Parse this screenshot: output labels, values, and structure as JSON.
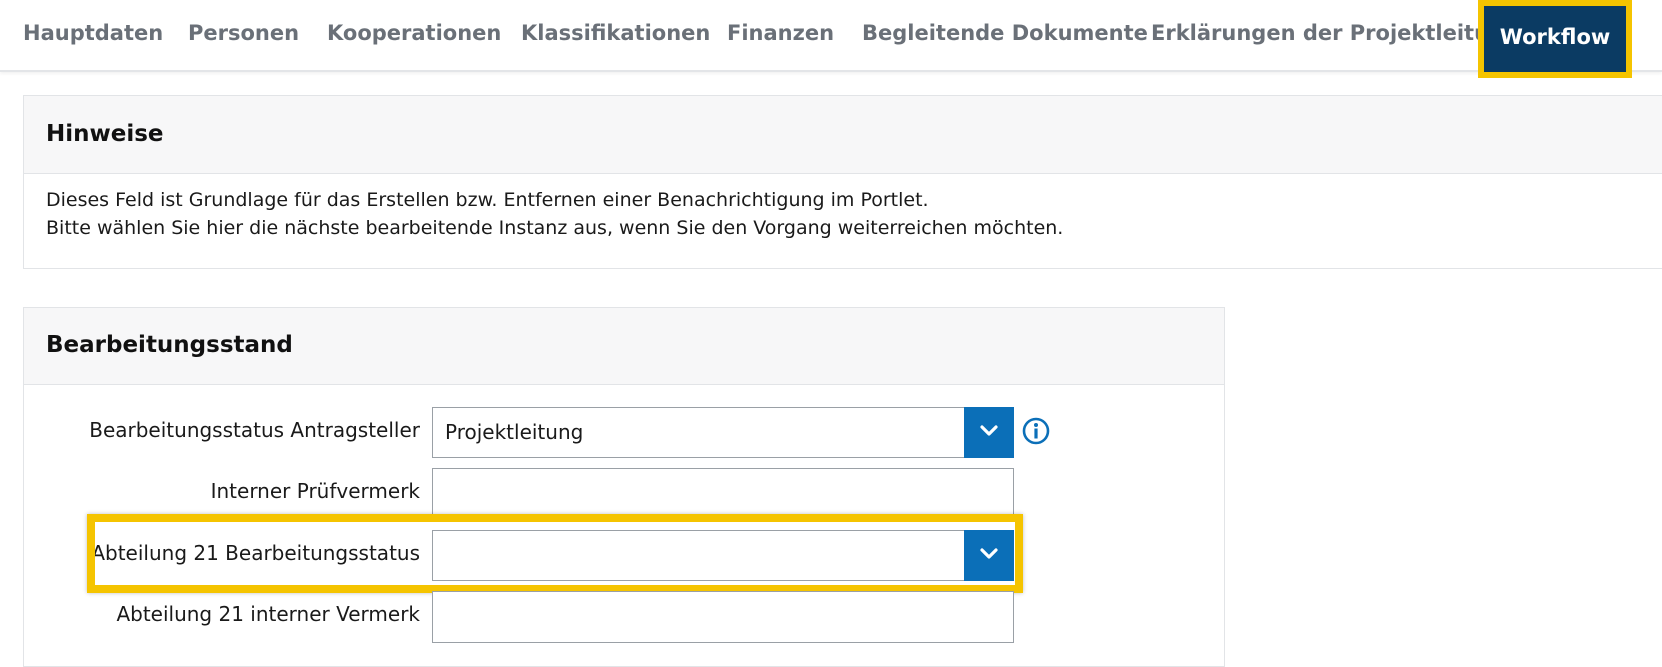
{
  "tabs": [
    {
      "label": "Hauptdaten"
    },
    {
      "label": "Personen"
    },
    {
      "label": "Kooperationen"
    },
    {
      "label": "Klassifikationen"
    },
    {
      "label": "Finanzen"
    },
    {
      "label": "Begleitende Dokumente"
    },
    {
      "label": "Erklärungen der Projektleitung"
    },
    {
      "label": "Workflow"
    }
  ],
  "active_tab": "Workflow",
  "hint_panel": {
    "title": "Hinweise",
    "lines": [
      "Dieses Feld ist Grundlage für das Erstellen bzw. Entfernen einer Benachrichtigung im Portlet.",
      "Bitte wählen Sie hier die nächste bearbeitende Instanz aus, wenn Sie den Vorgang weiterreichen möchten."
    ]
  },
  "state_panel": {
    "title": "Bearbeitungsstand",
    "fields": [
      {
        "label": "Bearbeitungsstatus Antragsteller",
        "value": "Projektleitung",
        "type": "select",
        "info_icon": "info-icon"
      },
      {
        "label": "Interner Prüfvermerk",
        "value": "",
        "type": "text"
      },
      {
        "label": "Abteilung 21 Bearbeitungsstatus",
        "value": "",
        "type": "select",
        "highlighted": true
      },
      {
        "label": "Abteilung 21 interner Vermerk",
        "value": "",
        "type": "text"
      }
    ]
  },
  "colors": {
    "active_tab_bg": "#0b3b63",
    "highlight": "#f5c400",
    "dropdown_button": "#0b6fb8",
    "info_icon": "#0b6fb8",
    "tab_text": "#6a7078"
  }
}
